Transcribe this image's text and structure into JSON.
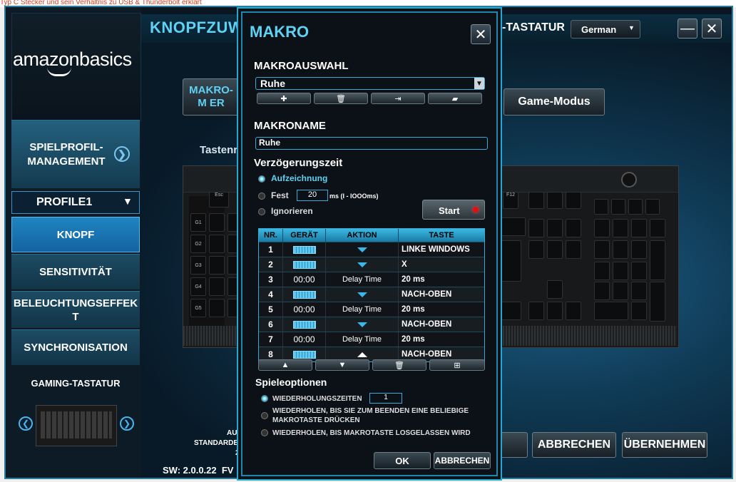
{
  "background_page": {
    "text": "Typ C Stecker und sein Verhältnis zu USB & Thunderbolt erklärt"
  },
  "sidebar": {
    "logo_text": "amazonbasics",
    "profile_manager": "SPIELPROFIL-MANAGEMENT",
    "profile_select": "PROFILE1",
    "items": [
      {
        "label": "KNOPF",
        "active": true
      },
      {
        "label": "SENSITIVITÄT",
        "active": false
      },
      {
        "label": "BELEUCHTUNGSEFFEKT",
        "active": false
      },
      {
        "label": "SYNCHRONISATION",
        "active": false
      }
    ],
    "device_label": "GAMING-TASTATUR"
  },
  "header": {
    "title": "KNOPFZUW",
    "title_right": "-TASTATUR",
    "language": "German",
    "colors": {
      "accent": "#5fd2f4",
      "active_tab": "#1f84c0"
    }
  },
  "main": {
    "macro_button": "MAKRO-M ER",
    "game_mode_button": "Game-Modus",
    "keys_label": "Tastenr",
    "info": {
      "line1": "AU",
      "line2": "STANDARDE",
      "line3": "2"
    },
    "sw_version": "SW: 2.0.0.22  FV",
    "cancel_button": "ABBRECHEN",
    "apply_button": "ÜBERNEHMEN"
  },
  "macro_dialog": {
    "title": "MAKRO",
    "selection_label": "MAKROAUSWAHL",
    "selected_macro": "Ruhe",
    "name_label": "MAKRONAME",
    "name_value": "Ruhe",
    "delay_label": "Verzögerungszeit",
    "delay_options": {
      "record": "Aufzeichnung",
      "fixed": "Fest",
      "ignore": "Ignorieren",
      "selected": "record"
    },
    "fixed_value": "20",
    "fixed_unit": "ms (I - IOOOms)",
    "start_button": "Start",
    "table_headers": [
      "NR.",
      "GERÄT",
      "AKTION",
      "TASTE"
    ],
    "rows": [
      {
        "nr": "1",
        "device": "keyboard",
        "action": "down",
        "key": "LINKE WINDOWS"
      },
      {
        "nr": "2",
        "device": "keyboard",
        "action": "down",
        "key": "X"
      },
      {
        "nr": "3",
        "device": "00:00",
        "action": "Delay Time",
        "key": "20 ms"
      },
      {
        "nr": "4",
        "device": "keyboard",
        "action": "down",
        "key": "NACH-OBEN"
      },
      {
        "nr": "5",
        "device": "00:00",
        "action": "Delay Time",
        "key": "20 ms"
      },
      {
        "nr": "6",
        "device": "keyboard",
        "action": "down",
        "key": "NACH-OBEN"
      },
      {
        "nr": "7",
        "device": "00:00",
        "action": "Delay Time",
        "key": "20 ms"
      },
      {
        "nr": "8",
        "device": "keyboard",
        "action": "up",
        "key": "NACH-OBEN"
      }
    ],
    "play_options_label": "Spieleoptionen",
    "play_options": {
      "repeat_count": "WIEDERHOLUNGSZEITEN",
      "repeat_until_other": "WIEDERHOLEN, BIS SIE ZUM BEENDEN EINE BELIEBIGE MAKROTASTE DRÜCKEN",
      "repeat_while_held": "WIEDERHOLEN, BIS MAKROTASTE LOSGELASSEN WIRD",
      "selected": "repeat_count"
    },
    "repeat_value": "1",
    "ok_button": "OK",
    "cancel_button": "ABBRECHEN"
  }
}
